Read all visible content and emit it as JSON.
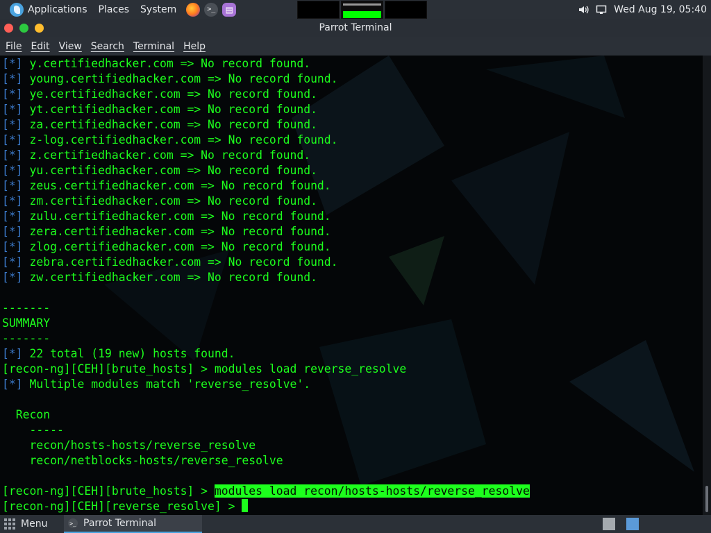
{
  "top_panel": {
    "applications": "Applications",
    "places": "Places",
    "system": "System",
    "clock": "Wed Aug 19, 05:40"
  },
  "window": {
    "title": "Parrot Terminal"
  },
  "menubar": {
    "file": "File",
    "edit": "Edit",
    "view": "View",
    "search": "Search",
    "terminal": "Terminal",
    "help": "Help"
  },
  "terminal": {
    "star": "[*]",
    "records": [
      "y.certifiedhacker.com => No record found.",
      "young.certifiedhacker.com => No record found.",
      "ye.certifiedhacker.com => No record found.",
      "yt.certifiedhacker.com => No record found.",
      "za.certifiedhacker.com => No record found.",
      "z-log.certifiedhacker.com => No record found.",
      "z.certifiedhacker.com => No record found.",
      "yu.certifiedhacker.com => No record found.",
      "zeus.certifiedhacker.com => No record found.",
      "zm.certifiedhacker.com => No record found.",
      "zulu.certifiedhacker.com => No record found.",
      "zera.certifiedhacker.com => No record found.",
      "zlog.certifiedhacker.com => No record found.",
      "zebra.certifiedhacker.com => No record found.",
      "zw.certifiedhacker.com => No record found."
    ],
    "dashes": "-------",
    "summary": "SUMMARY",
    "total": "22 total (19 new) hosts found.",
    "cmd1_prompt": "[recon-ng][CEH][brute_hosts] > ",
    "cmd1": "modules load reverse_resolve",
    "multiple": "Multiple modules match 'reverse_resolve'.",
    "recon_header": "  Recon",
    "recon_dashes": "    -----",
    "module1": "    recon/hosts-hosts/reverse_resolve",
    "module2": "    recon/netblocks-hosts/reverse_resolve",
    "cmd2_prompt": "[recon-ng][CEH][brute_hosts] > ",
    "cmd2": "modules load recon/hosts-hosts/reverse_resolve",
    "cmd3_prompt": "[recon-ng][CEH][reverse_resolve] > "
  },
  "bottom_panel": {
    "menu": "Menu",
    "task": "Parrot Terminal"
  },
  "colors": {
    "terminal_green": "#1dff1d",
    "star_blue": "#3b79c8",
    "panel_bg": "#2b3037"
  }
}
